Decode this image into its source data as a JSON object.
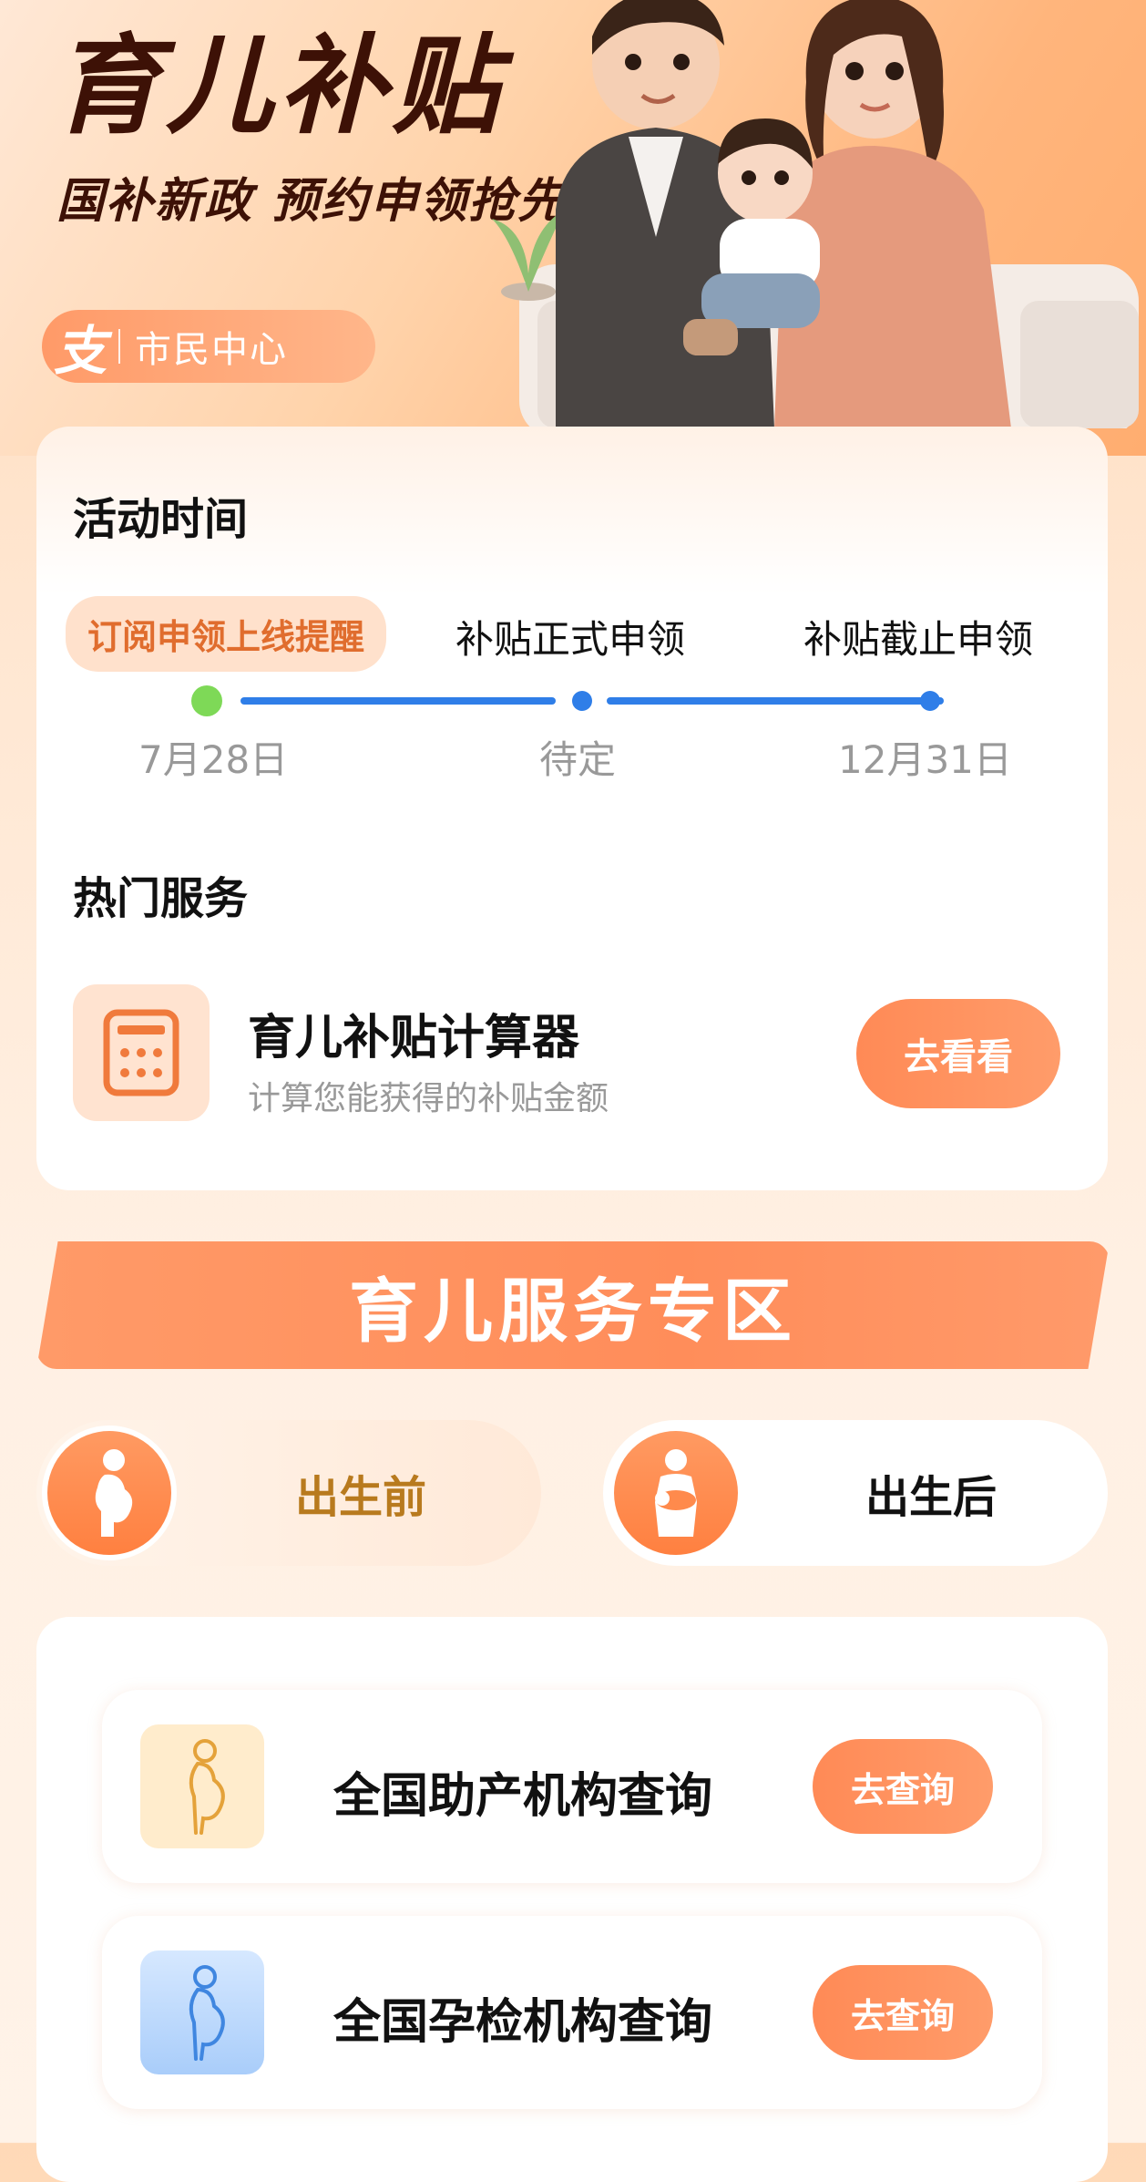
{
  "hero": {
    "title": "育儿补贴",
    "subtitle": "国补新政 预约申领抢先机",
    "badge_logo": "支",
    "badge_text": "市民中心"
  },
  "activity": {
    "title": "活动时间",
    "steps": [
      {
        "label": "订阅申领上线提醒",
        "date": "7月28日",
        "active": true
      },
      {
        "label": "补贴正式申领",
        "date": "待定",
        "active": false
      },
      {
        "label": "补贴截止申领",
        "date": "12月31日",
        "active": false
      }
    ]
  },
  "hot_services": {
    "title": "热门服务",
    "items": [
      {
        "title": "育儿补贴计算器",
        "subtitle": "计算您能获得的补贴金额",
        "button": "去看看",
        "icon": "calculator-icon"
      }
    ]
  },
  "zone": {
    "banner": "育儿服务专区",
    "tabs": [
      {
        "label": "出生前",
        "icon": "pregnant-woman-icon",
        "selected": true
      },
      {
        "label": "出生后",
        "icon": "mother-baby-icon",
        "selected": false
      }
    ],
    "items": [
      {
        "title": "全国助产机构查询",
        "button": "去查询",
        "icon": "pregnant-silhouette-icon"
      },
      {
        "title": "全国孕检机构查询",
        "button": "去查询",
        "icon": "pregnant-checkup-icon"
      }
    ]
  },
  "colors": {
    "accent": "#ff8d5a",
    "timeline_blue": "#2f7ee8",
    "active_dot": "#7ed957",
    "title_dark": "#3d1106",
    "selected_tab_text": "#b87a1e"
  }
}
